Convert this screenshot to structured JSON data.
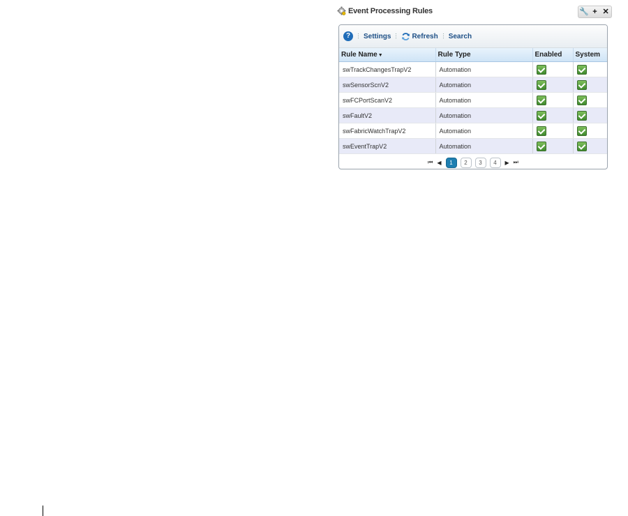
{
  "portlet": {
    "title": "Event Processing Rules",
    "controls": [
      "wrench-icon",
      "plus-icon",
      "close-icon"
    ]
  },
  "toolbar": {
    "help_icon": "help-icon",
    "settings_label": "Settings",
    "refresh_label": "Refresh",
    "search_label": "Search"
  },
  "table": {
    "columns": {
      "rule_name": "Rule Name",
      "rule_type": "Rule Type",
      "enabled": "Enabled",
      "system": "System"
    },
    "sorted_by": "Rule Name",
    "rows": [
      {
        "name": "swTrackChangesTrapV2",
        "type": "Automation",
        "enabled": true,
        "system": true
      },
      {
        "name": "swSensorScnV2",
        "type": "Automation",
        "enabled": true,
        "system": true
      },
      {
        "name": "swFCPortScanV2",
        "type": "Automation",
        "enabled": true,
        "system": true
      },
      {
        "name": "swFaultV2",
        "type": "Automation",
        "enabled": true,
        "system": true
      },
      {
        "name": "swFabricWatchTrapV2",
        "type": "Automation",
        "enabled": true,
        "system": true
      },
      {
        "name": "swEventTrapV2",
        "type": "Automation",
        "enabled": true,
        "system": true
      }
    ]
  },
  "pager": {
    "pages": [
      "1",
      "2",
      "3",
      "4"
    ],
    "current": "1"
  },
  "colors": {
    "accent": "#1d4f86",
    "header_bg": "#cfe4f6",
    "alt_row": "#e8eaf8",
    "active_page": "#1f7fb1",
    "check_green": "#3f8a2e"
  }
}
